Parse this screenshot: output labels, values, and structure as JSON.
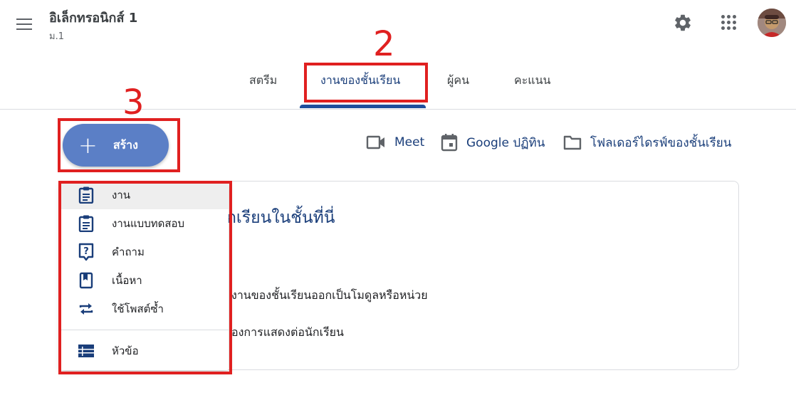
{
  "header": {
    "class_title": "อิเล็กทรอนิกส์ 1",
    "class_subtitle": "ม.1"
  },
  "tabs": [
    {
      "label": "สตรีม"
    },
    {
      "label": "งานของชั้นเรียน",
      "active": true
    },
    {
      "label": "ผู้คน"
    },
    {
      "label": "คะแนน"
    }
  ],
  "annotations": {
    "tab_number": "2",
    "create_number": "3"
  },
  "create_button": {
    "label": "สร้าง",
    "icon": "plus-icon"
  },
  "links": [
    {
      "label": "Meet",
      "icon": "video-camera-icon"
    },
    {
      "label": "Google ปฏิทิน",
      "icon": "calendar-icon"
    },
    {
      "label": "โฟลเดอร์ไดรฟ์ของชั้นเรียน",
      "icon": "folder-icon"
    }
  ],
  "card": {
    "heading": "กเรียนในชั้นที่นี่",
    "line1": "งานของชั้นเรียนออกเป็นโมดูลหรือหน่วย",
    "line2": "องการแสดงต่อนักเรียน"
  },
  "menu": {
    "items": [
      {
        "label": "งาน",
        "icon": "assignment-icon",
        "selected": true
      },
      {
        "label": "งานแบบทดสอบ",
        "icon": "quiz-assignment-icon"
      },
      {
        "label": "คำถาม",
        "icon": "question-icon"
      },
      {
        "label": "เนื้อหา",
        "icon": "material-icon"
      },
      {
        "label": "ใช้โพสต์ซ้ำ",
        "icon": "reuse-post-icon"
      }
    ],
    "topic": {
      "label": "หัวข้อ",
      "icon": "topic-list-icon"
    }
  },
  "colors": {
    "accent": "#1a3e7a",
    "create_button": "#5b7fc6",
    "annotation": "#e02020"
  }
}
